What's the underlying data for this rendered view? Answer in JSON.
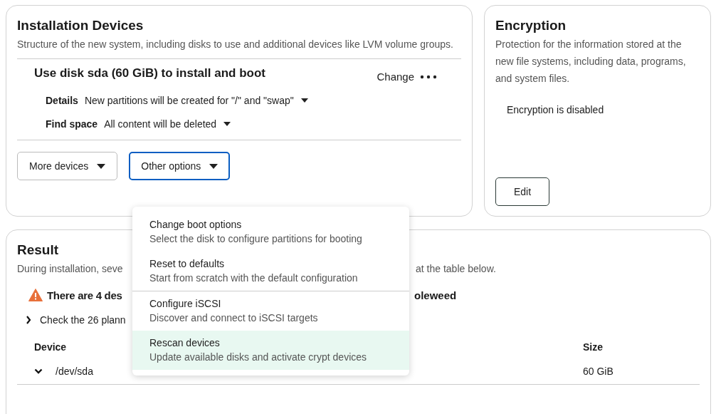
{
  "installation_devices": {
    "title": "Installation Devices",
    "description": "Structure of the new system, including disks to use and additional devices like LVM volume groups.",
    "drive": {
      "title": "Use disk sda (60 GiB) to install and boot",
      "action": "Change",
      "settings": [
        {
          "label": "Details",
          "value": "New partitions will be created for \"/\" and \"swap\""
        },
        {
          "label": "Find space",
          "value": "All content will be deleted"
        }
      ]
    },
    "buttons": [
      {
        "label": "More devices",
        "expanded": false
      },
      {
        "label": "Other options",
        "expanded": true
      }
    ]
  },
  "encryption": {
    "title": "Encryption",
    "description": "Protection for the information stored at the new file systems, including data, programs, and system files.",
    "status": "Encryption is disabled",
    "button": "Edit"
  },
  "result": {
    "title": "Result",
    "description_start": "During installation, seve",
    "description_end": "at the table below.",
    "warning_start": "There are 4 des",
    "warning_end": "oleweed",
    "details_toggle": {
      "label": "Check the 26 plann",
      "expanded": false
    },
    "table": {
      "columns": [
        {
          "label": "Device"
        },
        {
          "label": "Size"
        }
      ],
      "rows": [
        {
          "device": "/dev/sda",
          "size": "60 GiB",
          "expanded": true
        }
      ]
    }
  },
  "menu": {
    "groups": [
      [
        {
          "title": "Change boot options",
          "description": "Select the disk to configure partitions for booting",
          "selected": false
        },
        {
          "title": "Reset to defaults",
          "description": "Start from scratch with the default configuration",
          "selected": false
        }
      ],
      [
        {
          "title": "Configure iSCSI",
          "description": "Discover and connect to iSCSI targets",
          "selected": false
        },
        {
          "title": "Rescan devices",
          "description": "Update available disks and activate crypt devices",
          "selected": true
        }
      ]
    ]
  }
}
